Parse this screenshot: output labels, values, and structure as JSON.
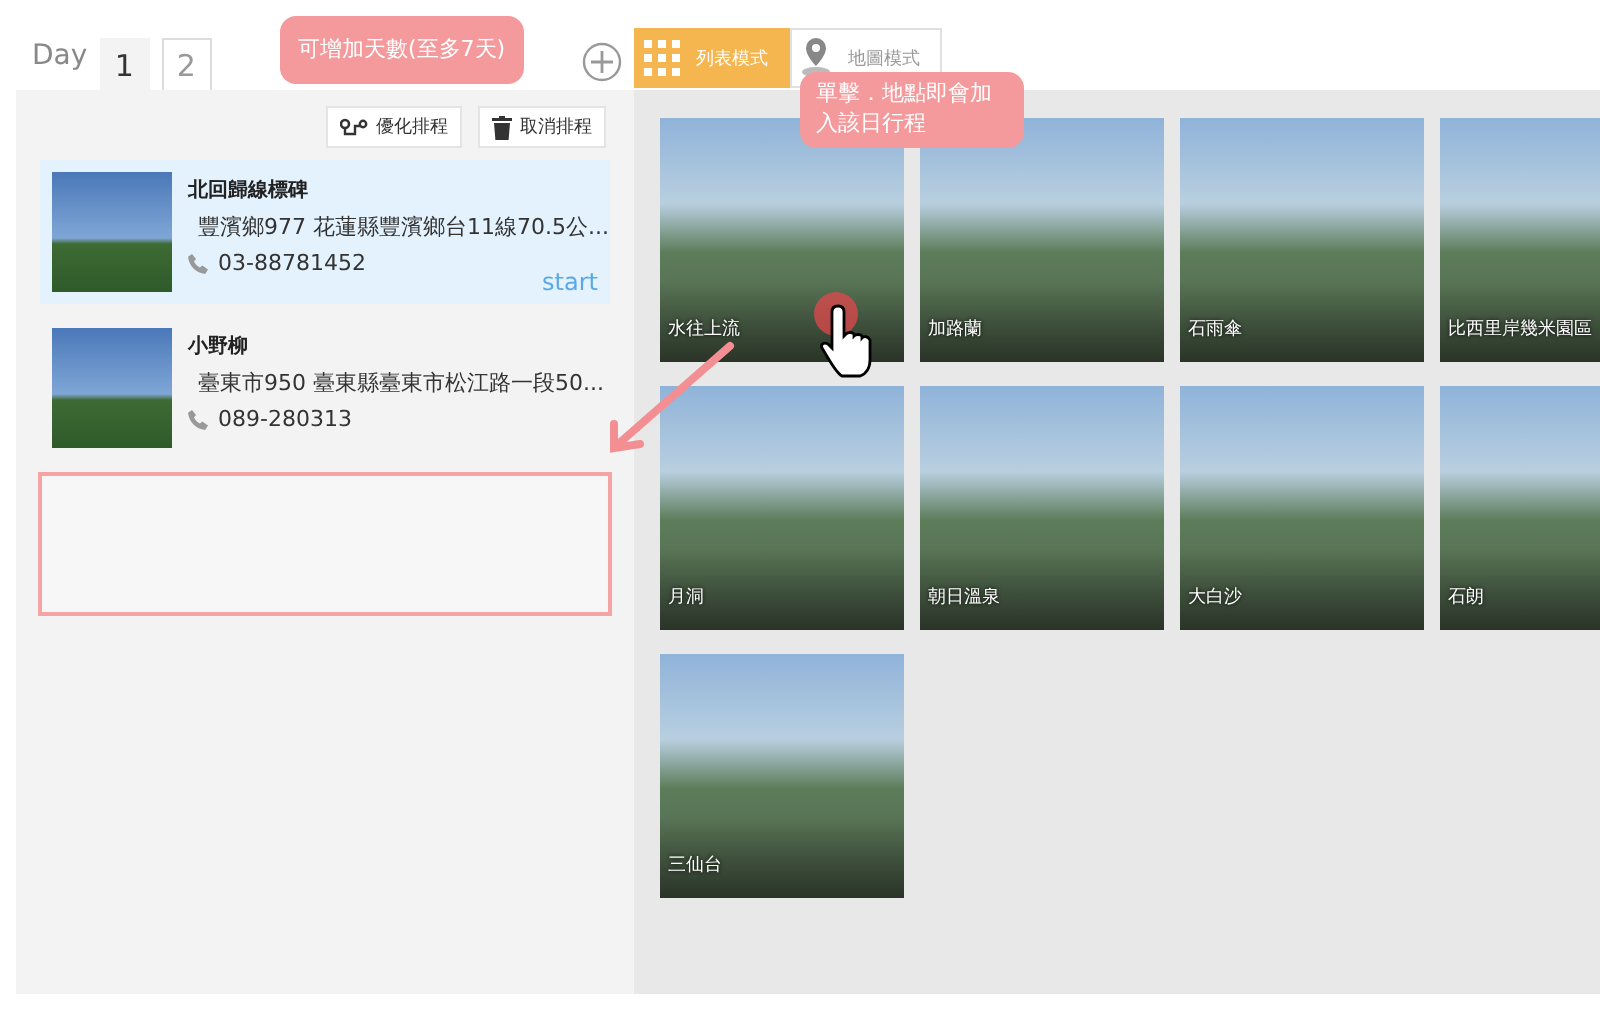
{
  "day_tabs": {
    "label": "Day",
    "tabs": [
      {
        "label": "1",
        "selected": true
      },
      {
        "label": "2",
        "selected": false
      }
    ]
  },
  "add_day_hint": "可增加天數(至多7天)",
  "view_modes": [
    {
      "label": "列表模式",
      "kind": "grid",
      "selected": true
    },
    {
      "label": "地圖模式",
      "kind": "map",
      "selected": false
    }
  ],
  "toolbar": [
    {
      "label": "優化排程",
      "kind": "route"
    },
    {
      "label": "取消排程",
      "kind": "trash"
    }
  ],
  "itinerary": [
    {
      "name": "北回歸線標碑",
      "address": "豐濱鄉977 花蓮縣豐濱鄉台11線70.5公...",
      "phone": "03-88781452",
      "badge": "start",
      "selected": true
    },
    {
      "name": "小野柳",
      "address": "臺東市950 臺東縣臺東市松江路一段50...",
      "phone": "089-280313",
      "selected": false
    }
  ],
  "click_hint": "單擊．地點即會加入該日行程",
  "places": [
    {
      "name": "水往上流"
    },
    {
      "name": "加路蘭"
    },
    {
      "name": "石雨傘"
    },
    {
      "name": "比西里岸幾米園區"
    },
    {
      "name": "月洞"
    },
    {
      "name": "朝日溫泉"
    },
    {
      "name": "大白沙"
    },
    {
      "name": "石朗"
    },
    {
      "name": "三仙台"
    }
  ]
}
